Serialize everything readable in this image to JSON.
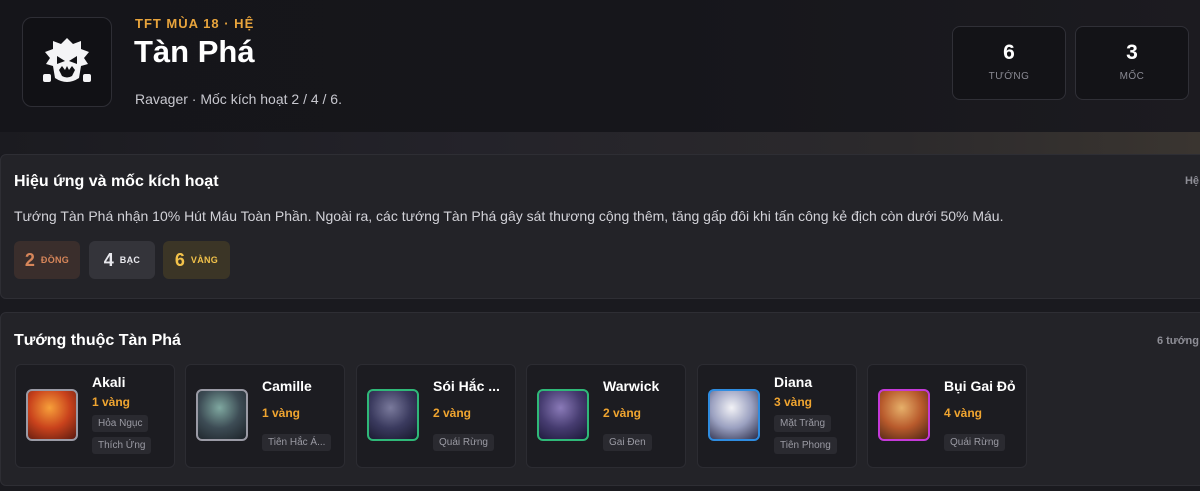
{
  "header": {
    "kicker": "TFT MÙA 18 · HỆ",
    "title": "Tàn Phá",
    "subtitle": "Ravager · Mốc kích hoạt 2 / 4 / 6.",
    "icon": "ravager-trait-icon",
    "stats": [
      {
        "value": "6",
        "label": "TƯỚNG"
      },
      {
        "value": "3",
        "label": "MỐC"
      }
    ]
  },
  "effects": {
    "title": "Hiệu ứng và mốc kích hoạt",
    "right_label": "Hệ",
    "description": "Tướng Tàn Phá nhận 10% Hút Máu Toàn Phần. Ngoài ra, các tướng Tàn Phá gây sát thương cộng thêm, tăng gấp đôi khi tấn công kẻ địch còn dưới 50% Máu.",
    "tiers": [
      {
        "count": "2",
        "name": "ĐỒNG",
        "color": "#d7865a",
        "bg": "#3a2e2c"
      },
      {
        "count": "4",
        "name": "BẠC",
        "color": "#e9e9ee",
        "bg": "#34343a"
      },
      {
        "count": "6",
        "name": "VÀNG",
        "color": "#f2c24a",
        "bg": "#3b3526"
      }
    ]
  },
  "champions": {
    "title": "Tướng thuộc Tàn Phá",
    "right_label": "6 tướng",
    "items": [
      {
        "name": "Akali",
        "cost": "1 vàng",
        "tags": [
          "Hỏa Ngục",
          "Thích Ứng"
        ],
        "border": "#9a9aa5",
        "cost_color": "#f0a530",
        "art": [
          "#f7a03a",
          "#c9421c",
          "#5a1a10"
        ]
      },
      {
        "name": "Camille",
        "cost": "1 vàng",
        "tags": [
          "Tiên Hắc Á..."
        ],
        "border": "#9a9aa5",
        "cost_color": "#f0a530",
        "art": [
          "#7fa8a0",
          "#3d4c55",
          "#1c2228"
        ]
      },
      {
        "name": "Sói Hắc ...",
        "cost": "2 vàng",
        "tags": [
          "Quái Rừng"
        ],
        "border": "#2fb878",
        "cost_color": "#f0a530",
        "art": [
          "#7a7a9c",
          "#3a3a5e",
          "#16162a"
        ]
      },
      {
        "name": "Warwick",
        "cost": "2 vàng",
        "tags": [
          "Gai Đen"
        ],
        "border": "#2fb878",
        "cost_color": "#f0a530",
        "art": [
          "#8a7ab8",
          "#463c70",
          "#1a1636"
        ]
      },
      {
        "name": "Diana",
        "cost": "3 vàng",
        "tags": [
          "Mặt Trăng",
          "Tiên Phong"
        ],
        "border": "#2f8ce0",
        "cost_color": "#f0a530",
        "art": [
          "#f2f2f6",
          "#9aa0c0",
          "#2a2c48"
        ]
      },
      {
        "name": "Bụi Gai Đỏ",
        "cost": "4 vàng",
        "tags": [
          "Quái Rừng"
        ],
        "border": "#c43ad8",
        "cost_color": "#f0a530",
        "art": [
          "#e6b06a",
          "#b85a2c",
          "#4a2414"
        ]
      }
    ]
  }
}
